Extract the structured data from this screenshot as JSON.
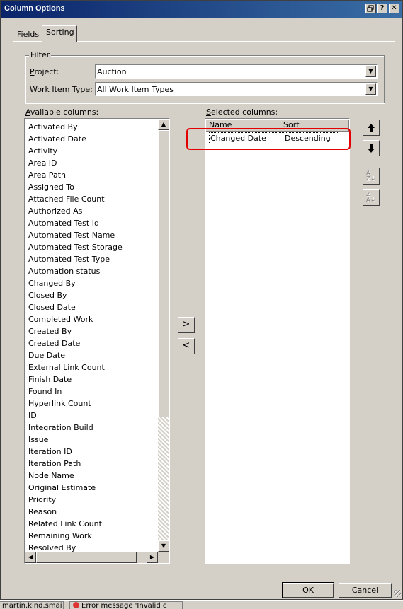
{
  "window": {
    "title": "Column Options",
    "help_glyph": "?",
    "close_glyph": "✕"
  },
  "tabs": [
    {
      "label": "Fields"
    },
    {
      "label": "Sorting",
      "active": true
    }
  ],
  "filter": {
    "legend": "Filter",
    "project_label_u": "P",
    "project_label_rest": "roject:",
    "project_value": "Auction",
    "wit_label_pre": "Work ",
    "wit_label_u": "I",
    "wit_label_post": "tem Type:",
    "wit_value": "All Work Item Types"
  },
  "available": {
    "label_u": "A",
    "label_rest": "vailable columns:",
    "items": [
      "Activated By",
      "Activated Date",
      "Activity",
      "Area ID",
      "Area Path",
      "Assigned To",
      "Attached File Count",
      "Authorized As",
      "Automated Test Id",
      "Automated Test Name",
      "Automated Test Storage",
      "Automated Test Type",
      "Automation status",
      "Changed By",
      "Closed By",
      "Closed Date",
      "Completed Work",
      "Created By",
      "Created Date",
      "Due Date",
      "External Link Count",
      "Finish Date",
      "Found In",
      "Hyperlink Count",
      "ID",
      "Integration Build",
      "Issue",
      "Iteration ID",
      "Iteration Path",
      "Node Name",
      "Original Estimate",
      "Priority",
      "Reason",
      "Related Link Count",
      "Remaining Work",
      "Resolved By"
    ]
  },
  "selected": {
    "label_u": "S",
    "label_rest": "elected columns:",
    "columns": [
      "Name",
      "Sort"
    ],
    "rows": [
      {
        "name": "Changed Date",
        "sort": "Descending"
      }
    ]
  },
  "move": {
    "add_glyph": ">",
    "remove_glyph": "<"
  },
  "order": {
    "up_glyph": "🡅",
    "down_glyph": "🡇",
    "sort_asc_top": "A",
    "sort_asc_bottom": "Z",
    "sort_desc_top": "Z",
    "sort_desc_bottom": "A"
  },
  "footer": {
    "ok": "OK",
    "cancel": "Cancel"
  },
  "taskbar": {
    "items": [
      "martin.kind.smai",
      "Error message 'Invalid c"
    ]
  },
  "colors": {
    "titlebar_start": "#0a246a",
    "titlebar_end": "#3a6ea5",
    "dialog_face": "#d4d0c8",
    "highlight_annotation": "#e40000"
  }
}
